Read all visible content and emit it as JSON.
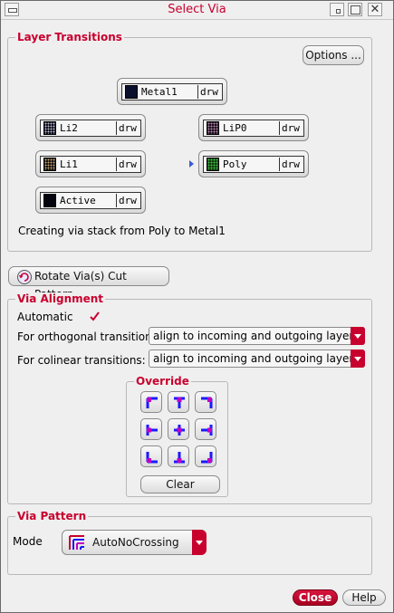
{
  "window": {
    "title": "Select Via"
  },
  "layer_transitions": {
    "title": "Layer Transitions",
    "options_label": "Options ...",
    "layers": {
      "metal1": {
        "name": "Metal1",
        "purpose": "drw"
      },
      "li2": {
        "name": "Li2",
        "purpose": "drw"
      },
      "lip0": {
        "name": "LiP0",
        "purpose": "drw"
      },
      "li1": {
        "name": "Li1",
        "purpose": "drw"
      },
      "poly": {
        "name": "Poly",
        "purpose": "drw"
      },
      "active": {
        "name": "Active",
        "purpose": "drw"
      }
    },
    "status": "Creating via stack from Poly to Metal1"
  },
  "rotate_button": {
    "label": "Rotate Via(s) Cut Pattern"
  },
  "via_alignment": {
    "title": "Via Alignment",
    "automatic_label": "Automatic",
    "automatic_checked": true,
    "orthogonal_label": "For orthogonal transitions:",
    "orthogonal_value": "align to incoming and outgoing layers",
    "colinear_label": "For colinear transitions:",
    "colinear_value": "align to incoming and outgoing layers",
    "override": {
      "title": "Override",
      "clear_label": "Clear",
      "buttons": [
        "top-left",
        "top-center",
        "top-right",
        "middle-left",
        "center",
        "middle-right",
        "bottom-left",
        "bottom-center",
        "bottom-right"
      ]
    }
  },
  "via_pattern": {
    "title": "Via Pattern",
    "mode_label": "Mode",
    "mode_value": "AutoNoCrossing"
  },
  "footer": {
    "close_label": "Close",
    "help_label": "Help"
  },
  "colors": {
    "accent": "#c8002e",
    "blue": "#1a1aff",
    "magenta": "#c000c0"
  }
}
